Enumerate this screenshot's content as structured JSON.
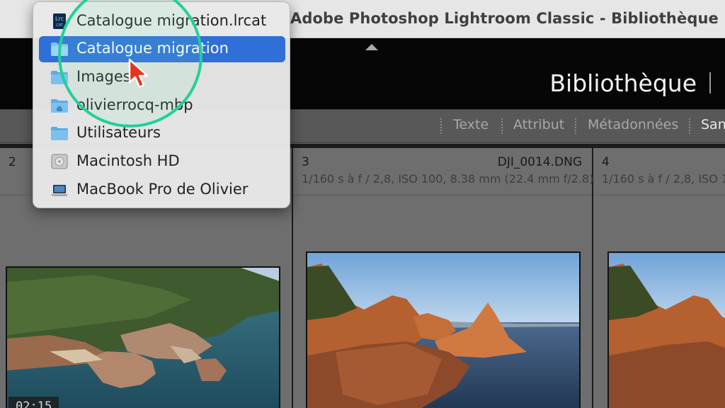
{
  "window": {
    "title": "Adobe Photoshop Lightroom Classic - Bibliothèque"
  },
  "module": {
    "name": "Bibliothèque"
  },
  "filter_bar": {
    "items": [
      "Texte",
      "Attribut",
      "Métadonnées",
      "San"
    ]
  },
  "grid": {
    "cells": [
      {
        "number": "2",
        "filename": "",
        "meta": "",
        "duration": "02:15"
      },
      {
        "number": "3",
        "filename": "DJI_0014.DNG",
        "meta": "1/160 s à f / 2,8, ISO 100, 8.38 mm (22.4 mm f/2.8)"
      },
      {
        "number": "4",
        "filename": "",
        "meta": "1/160 s à f / 2,8, ISO 10"
      }
    ]
  },
  "dropdown": {
    "items": [
      {
        "label": "Catalogue migration.lrcat",
        "icon": "lrcat-file-icon",
        "selected": false
      },
      {
        "label": "Catalogue migration",
        "icon": "folder-icon",
        "selected": true
      },
      {
        "label": "Images",
        "icon": "folder-icon",
        "selected": false
      },
      {
        "label": "olivierrocq-mbp",
        "icon": "home-folder-icon",
        "selected": false
      },
      {
        "label": "Utilisateurs",
        "icon": "folder-icon",
        "selected": false
      },
      {
        "label": "Macintosh HD",
        "icon": "hard-drive-icon",
        "selected": false
      },
      {
        "label": "MacBook Pro de Olivier",
        "icon": "laptop-icon",
        "selected": false
      }
    ]
  },
  "icon_text": {
    "lrc": "Lrc",
    "cat": "CAT"
  },
  "colors": {
    "selection": "#2f6fd8",
    "highlight_ring": "#22cf9a",
    "cursor": "#e8321f"
  }
}
